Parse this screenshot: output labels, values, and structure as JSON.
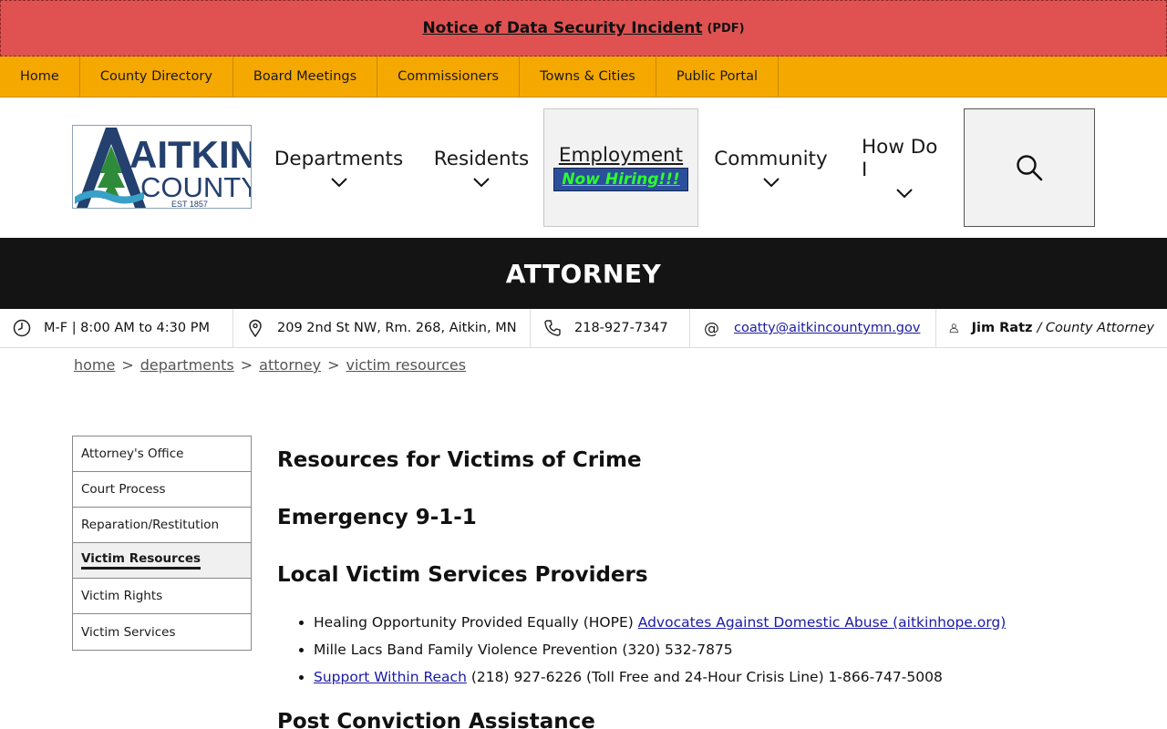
{
  "alert": {
    "link_text": "Notice of Data Security Incident",
    "suffix": "(PDF)"
  },
  "topnav": [
    "Home",
    "County Directory",
    "Board Meetings",
    "Commissioners",
    "Towns & Cities",
    "Public Portal"
  ],
  "logo": {
    "line1": "AITKIN",
    "line2": "COUNTY",
    "est": "EST 1857"
  },
  "mainnav": {
    "departments": "Departments",
    "residents": "Residents",
    "employment": "Employment",
    "hiring": "Now Hiring!!!",
    "community": "Community",
    "how_do_i": "How Do I"
  },
  "page_title": "ATTORNEY",
  "info": {
    "hours": "M-F | 8:00 AM to 4:30 PM",
    "address": "209 2nd St NW, Rm. 268, Aitkin, MN",
    "phone": "218-927-7347",
    "email": "coatty@aitkincountymn.gov",
    "contact_name": "Jim Ratz",
    "contact_title": "/ County Attorney"
  },
  "breadcrumb": [
    "home",
    "departments",
    "attorney",
    "victim resources"
  ],
  "sidebar": [
    {
      "label": "Attorney's Office"
    },
    {
      "label": "Court Process"
    },
    {
      "label": "Reparation/Restitution"
    },
    {
      "label": "Victim Resources"
    },
    {
      "label": "Victim Rights"
    },
    {
      "label": "Victim Services"
    }
  ],
  "content": {
    "heading1": "Resources for Victims of Crime",
    "heading2": "Emergency 9-1-1",
    "heading3": "Local Victim Services Providers",
    "items": [
      {
        "text": "Healing Opportunity Provided Equally (HOPE)",
        "link": "Advocates Against Domestic Abuse (aitkinhope.org)"
      },
      {
        "text": "Mille Lacs Band Family Violence Prevention (320) 532-7875"
      },
      {
        "link": "Support Within Reach",
        "text": "(218) 927-6226 (Toll Free and 24-Hour Crisis Line) 1-866-747-5008"
      }
    ],
    "heading4_partial": "Post Conviction Assistance"
  },
  "colors": {
    "alert_bg": "#e05252",
    "topnav_bg": "#f5a800",
    "band_bg": "#141414",
    "hiring_bg": "#2b4f9a",
    "hiring_text": "#2bff2b"
  }
}
